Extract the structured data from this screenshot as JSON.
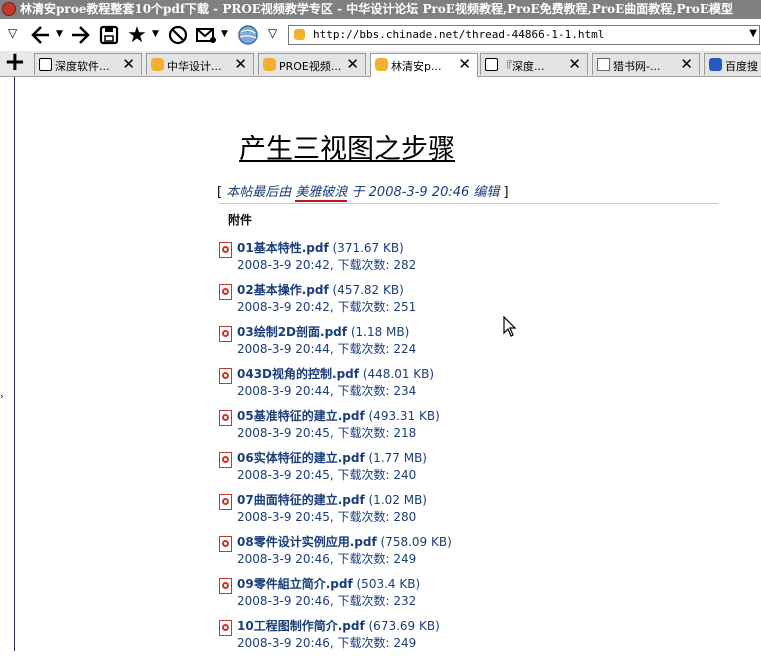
{
  "window": {
    "title": "林清安proe教程整套10个pdf下载 - PROE视频教学专区 - 中华设计论坛 ProE视频教程,ProE免费教程,ProE曲面教程,ProE模型"
  },
  "toolbar": {
    "url": "http://bbs.chinade.net/thread-44866-1-1.html"
  },
  "tabs": [
    {
      "label": "深度软件...",
      "icon": "doc-icon"
    },
    {
      "label": "中华设计...",
      "icon": "bug-icon"
    },
    {
      "label": "PROE视频...",
      "icon": "bug-icon"
    },
    {
      "label": "林清安p...",
      "icon": "bug-icon",
      "active": true
    },
    {
      "label": "『深度...",
      "icon": "doc-icon"
    },
    {
      "label": "猎书网-...",
      "icon": "link-icon"
    },
    {
      "label": "百度搜",
      "icon": "paw-icon"
    }
  ],
  "post": {
    "title": "产生三视图之步骤",
    "edit_open": "[",
    "edit_prefix": "本帖最后由",
    "edit_user": "美雅破浪",
    "edit_suffix": "于 2008-3-9 20:46 编辑",
    "edit_close": "]",
    "attachments_heading": "附件"
  },
  "attachments": [
    {
      "name": "01基本特性.pdf",
      "size": "(371.67 KB)",
      "meta": "2008-3-9 20:42, 下载次数: 282"
    },
    {
      "name": "02基本操作.pdf",
      "size": "(457.82 KB)",
      "meta": "2008-3-9 20:42, 下载次数: 251"
    },
    {
      "name": "03绘制2D剖面.pdf",
      "size": "(1.18 MB)",
      "meta": "2008-3-9 20:44, 下载次数: 224"
    },
    {
      "name": "043D视角的控制.pdf",
      "size": "(448.01 KB)",
      "meta": "2008-3-9 20:44, 下载次数: 234"
    },
    {
      "name": "05基准特征的建立.pdf",
      "size": "(493.31 KB)",
      "meta": "2008-3-9 20:45, 下载次数: 218"
    },
    {
      "name": "06实体特征的建立.pdf",
      "size": "(1.77 MB)",
      "meta": "2008-3-9 20:45, 下载次数: 240"
    },
    {
      "name": "07曲面特征的建立.pdf",
      "size": "(1.02 MB)",
      "meta": "2008-3-9 20:45, 下载次数: 280"
    },
    {
      "name": "08零件设计实例应用.pdf",
      "size": "(758.09 KB)",
      "meta": "2008-3-9 20:46, 下载次数: 249"
    },
    {
      "name": "09零件組立简介.pdf",
      "size": "(503.4 KB)",
      "meta": "2008-3-9 20:46, 下载次数: 232"
    },
    {
      "name": "10工程图制作简介.pdf",
      "size": "(673.69 KB)",
      "meta": "2008-3-9 20:46, 下载次数: 249"
    }
  ]
}
